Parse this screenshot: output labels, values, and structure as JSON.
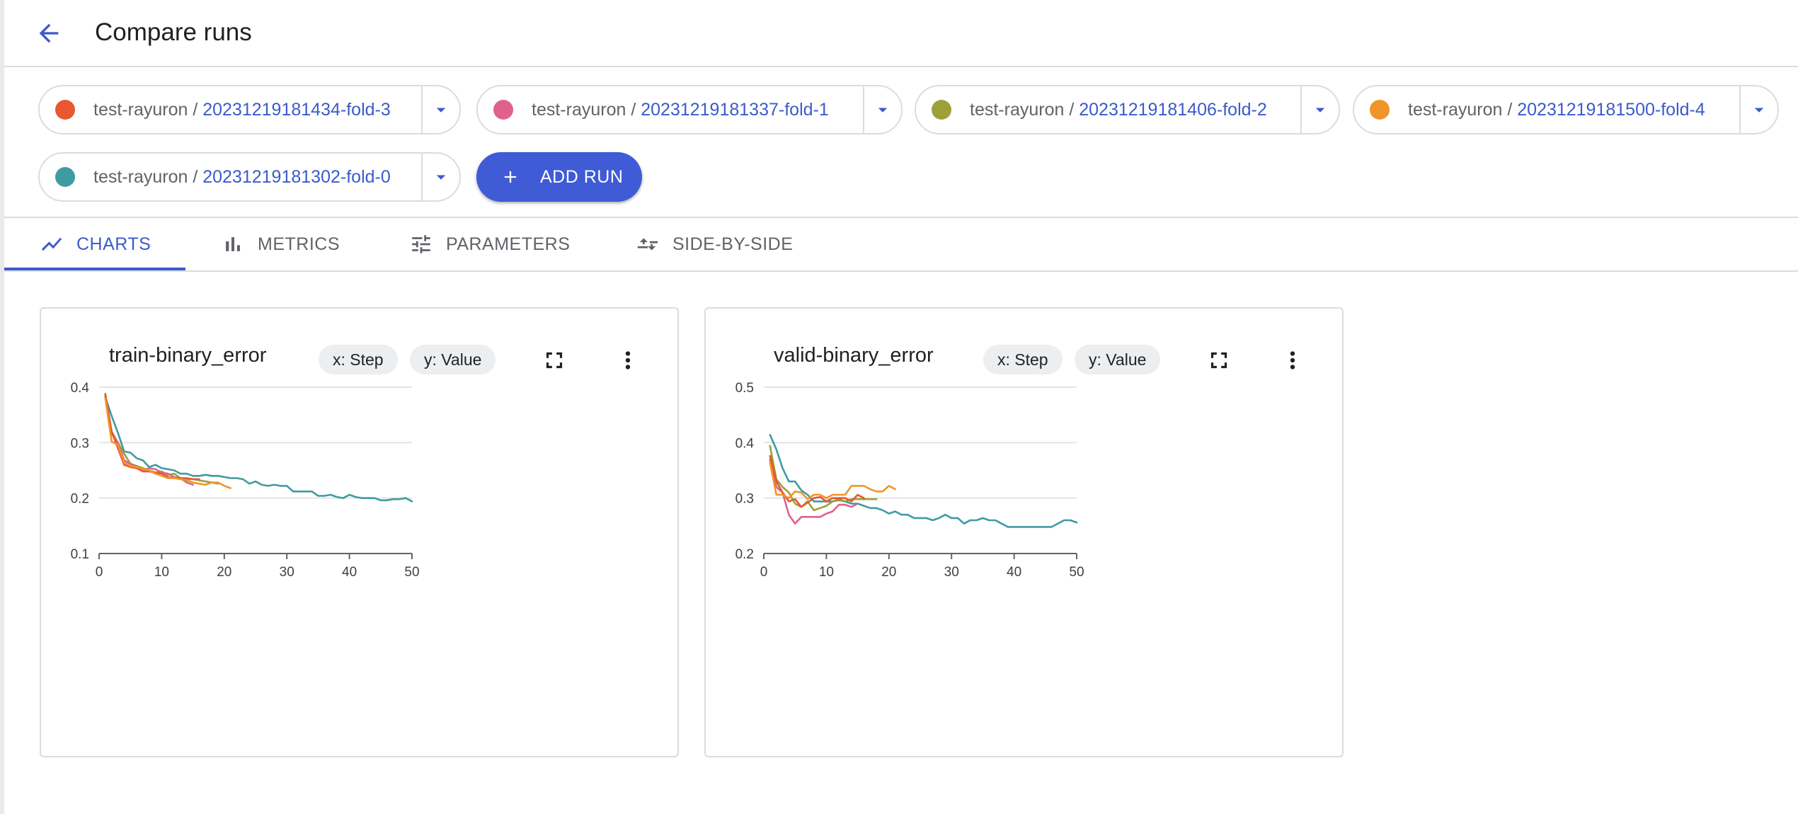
{
  "header": {
    "title": "Compare runs",
    "back_icon": "arrow-back-icon"
  },
  "runs": [
    {
      "experiment": "test-rayuron",
      "separator": " / ",
      "run": "20231219181434-fold-3",
      "color": "#e8572f"
    },
    {
      "experiment": "test-rayuron",
      "separator": " / ",
      "run": "20231219181337-fold-1",
      "color": "#e0628c"
    },
    {
      "experiment": "test-rayuron",
      "separator": " / ",
      "run": "20231219181406-fold-2",
      "color": "#9ba136"
    },
    {
      "experiment": "test-rayuron",
      "separator": " / ",
      "run": "20231219181500-fold-4",
      "color": "#f0952a"
    },
    {
      "experiment": "test-rayuron",
      "separator": " / ",
      "run": "20231219181302-fold-0",
      "color": "#3f9ba3"
    }
  ],
  "add_run_label": "ADD RUN",
  "tabs": [
    {
      "label": "CHARTS",
      "icon": "line-chart-icon",
      "active": true
    },
    {
      "label": "METRICS",
      "icon": "bar-chart-icon",
      "active": false
    },
    {
      "label": "PARAMETERS",
      "icon": "tune-icon",
      "active": false
    },
    {
      "label": "SIDE-BY-SIDE",
      "icon": "compare-arrows-icon",
      "active": false
    }
  ],
  "chart_controls": {
    "x_pill": "x: Step",
    "y_pill": "y: Value"
  },
  "chart_data": [
    {
      "type": "line",
      "title": "train-binary_error",
      "xlabel": "",
      "ylabel": "",
      "xlim": [
        0,
        50
      ],
      "ylim": [
        0.1,
        0.4
      ],
      "x_ticks": [
        0,
        10,
        20,
        30,
        40,
        50
      ],
      "y_ticks": [
        0.1,
        0.2,
        0.3,
        0.4
      ],
      "grid": true,
      "series": [
        {
          "color": "#3f9ba3",
          "x": [
            1,
            2,
            3,
            4,
            5,
            6,
            7,
            8,
            9,
            10,
            11,
            12,
            13,
            14,
            15,
            16,
            17,
            18,
            19,
            20,
            21,
            22,
            23,
            24,
            25,
            26,
            27,
            28,
            29,
            30,
            31,
            32,
            33,
            34,
            35,
            36,
            37,
            38,
            39,
            40,
            41,
            42,
            43,
            44,
            45,
            46,
            47,
            48,
            49,
            50
          ],
          "y": [
            0.382,
            0.348,
            0.318,
            0.284,
            0.282,
            0.272,
            0.268,
            0.256,
            0.26,
            0.254,
            0.252,
            0.25,
            0.244,
            0.244,
            0.24,
            0.24,
            0.242,
            0.24,
            0.24,
            0.238,
            0.236,
            0.236,
            0.234,
            0.226,
            0.23,
            0.224,
            0.222,
            0.224,
            0.222,
            0.222,
            0.212,
            0.212,
            0.212,
            0.212,
            0.204,
            0.204,
            0.206,
            0.202,
            0.2,
            0.206,
            0.202,
            0.2,
            0.2,
            0.2,
            0.196,
            0.196,
            0.198,
            0.198,
            0.2,
            0.194
          ]
        },
        {
          "color": "#9ba136",
          "x": [
            1,
            2,
            3,
            4,
            5,
            6,
            7,
            8,
            9,
            10,
            11,
            12,
            13,
            14,
            15,
            16,
            17,
            18,
            19
          ],
          "y": [
            0.384,
            0.32,
            0.3,
            0.28,
            0.262,
            0.258,
            0.254,
            0.25,
            0.246,
            0.248,
            0.242,
            0.244,
            0.236,
            0.234,
            0.234,
            0.232,
            0.23,
            0.228,
            0.226
          ]
        },
        {
          "color": "#e0628c",
          "x": [
            1,
            2,
            3,
            4,
            5,
            6,
            7,
            8,
            9,
            10,
            11,
            12,
            13,
            14,
            15
          ],
          "y": [
            0.386,
            0.316,
            0.3,
            0.268,
            0.262,
            0.256,
            0.25,
            0.254,
            0.252,
            0.246,
            0.244,
            0.238,
            0.236,
            0.228,
            0.224
          ]
        },
        {
          "color": "#e8572f",
          "x": [
            1,
            2,
            3,
            4,
            5,
            6,
            7,
            8,
            9,
            10,
            11,
            12,
            13,
            14,
            15,
            16
          ],
          "y": [
            0.388,
            0.32,
            0.29,
            0.26,
            0.256,
            0.254,
            0.248,
            0.248,
            0.246,
            0.244,
            0.238,
            0.236,
            0.236,
            0.236,
            0.234,
            0.234
          ]
        },
        {
          "color": "#f0952a",
          "x": [
            1,
            2,
            3,
            4,
            5,
            6,
            7,
            8,
            9,
            10,
            11,
            12,
            13,
            14,
            15,
            16,
            17,
            18,
            19,
            20,
            21
          ],
          "y": [
            0.38,
            0.302,
            0.296,
            0.264,
            0.258,
            0.256,
            0.252,
            0.25,
            0.244,
            0.24,
            0.236,
            0.236,
            0.234,
            0.232,
            0.228,
            0.226,
            0.224,
            0.228,
            0.228,
            0.222,
            0.218
          ]
        }
      ]
    },
    {
      "type": "line",
      "title": "valid-binary_error",
      "xlabel": "",
      "ylabel": "",
      "xlim": [
        0,
        50
      ],
      "ylim": [
        0.2,
        0.5
      ],
      "x_ticks": [
        0,
        10,
        20,
        30,
        40,
        50
      ],
      "y_ticks": [
        0.2,
        0.3,
        0.4,
        0.5
      ],
      "grid": true,
      "series": [
        {
          "color": "#3f9ba3",
          "x": [
            1,
            2,
            3,
            4,
            5,
            6,
            7,
            8,
            9,
            10,
            11,
            12,
            13,
            14,
            15,
            16,
            17,
            18,
            19,
            20,
            21,
            22,
            23,
            24,
            25,
            26,
            27,
            28,
            29,
            30,
            31,
            32,
            33,
            34,
            35,
            36,
            37,
            38,
            39,
            40,
            41,
            42,
            43,
            44,
            45,
            46,
            47,
            48,
            49,
            50
          ],
          "y": [
            0.414,
            0.388,
            0.354,
            0.33,
            0.33,
            0.314,
            0.306,
            0.294,
            0.294,
            0.294,
            0.294,
            0.298,
            0.294,
            0.29,
            0.29,
            0.286,
            0.282,
            0.282,
            0.278,
            0.272,
            0.276,
            0.27,
            0.27,
            0.264,
            0.264,
            0.264,
            0.26,
            0.264,
            0.27,
            0.264,
            0.264,
            0.254,
            0.26,
            0.26,
            0.264,
            0.26,
            0.26,
            0.254,
            0.248,
            0.248,
            0.248,
            0.248,
            0.248,
            0.248,
            0.248,
            0.248,
            0.254,
            0.26,
            0.26,
            0.256
          ]
        },
        {
          "color": "#9ba136",
          "x": [
            1,
            2,
            3,
            4,
            5,
            6,
            7,
            8,
            9,
            10,
            11,
            12,
            13,
            14,
            15,
            16,
            17,
            18
          ],
          "y": [
            0.394,
            0.334,
            0.32,
            0.31,
            0.29,
            0.284,
            0.294,
            0.278,
            0.282,
            0.286,
            0.294,
            0.296,
            0.294,
            0.298,
            0.298,
            0.298,
            0.298,
            0.298
          ]
        },
        {
          "color": "#e0628c",
          "x": [
            1,
            2,
            3,
            4,
            5,
            6,
            7,
            8,
            9,
            10,
            11,
            12,
            13,
            14,
            15
          ],
          "y": [
            0.37,
            0.32,
            0.31,
            0.27,
            0.254,
            0.266,
            0.266,
            0.266,
            0.266,
            0.272,
            0.276,
            0.288,
            0.288,
            0.284,
            0.29
          ]
        },
        {
          "color": "#e8572f",
          "x": [
            1,
            2,
            3,
            4,
            5,
            6,
            7,
            8,
            9,
            10,
            11,
            12,
            13,
            14,
            15,
            16
          ],
          "y": [
            0.376,
            0.33,
            0.31,
            0.294,
            0.298,
            0.284,
            0.292,
            0.3,
            0.302,
            0.294,
            0.3,
            0.3,
            0.3,
            0.294,
            0.306,
            0.3
          ]
        },
        {
          "color": "#f0952a",
          "x": [
            1,
            2,
            3,
            4,
            5,
            6,
            7,
            8,
            9,
            10,
            11,
            12,
            13,
            14,
            15,
            16,
            17,
            18,
            19,
            20,
            21
          ],
          "y": [
            0.364,
            0.306,
            0.306,
            0.3,
            0.312,
            0.31,
            0.298,
            0.306,
            0.306,
            0.3,
            0.306,
            0.306,
            0.306,
            0.322,
            0.322,
            0.322,
            0.316,
            0.312,
            0.312,
            0.322,
            0.316
          ]
        }
      ]
    }
  ]
}
